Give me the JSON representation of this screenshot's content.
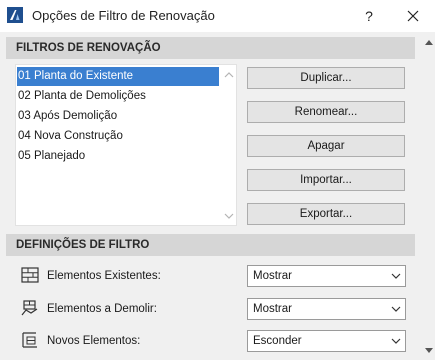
{
  "window": {
    "title": "Opções de Filtro de Renovação",
    "help_label": "?",
    "icon": "archicad-app-icon",
    "close_icon": "close-icon"
  },
  "filters_section": {
    "header": "FILTROS DE RENOVAÇÃO",
    "items": [
      {
        "label": "01 Planta do Existente",
        "selected": true
      },
      {
        "label": "02 Planta de Demolições",
        "selected": false
      },
      {
        "label": "03 Após Demolição",
        "selected": false
      },
      {
        "label": "04 Nova Construção",
        "selected": false
      },
      {
        "label": "05 Planejado",
        "selected": false
      }
    ],
    "buttons": {
      "duplicate": "Duplicar...",
      "rename": "Renomear...",
      "delete": "Apagar",
      "import": "Importar...",
      "export": "Exportar..."
    }
  },
  "settings_section": {
    "header": "DEFINIÇÕES DE FILTRO",
    "rows": [
      {
        "label": "Elementos Existentes:",
        "value": "Mostrar",
        "icon": "existing-elements-icon"
      },
      {
        "label": "Elementos a Demolir:",
        "value": "Mostrar",
        "icon": "demolish-elements-icon"
      },
      {
        "label": "Novos Elementos:",
        "value": "Esconder",
        "icon": "new-elements-icon"
      }
    ]
  },
  "colors": {
    "selection": "#3a7fd0",
    "section_header_bg": "#d6d6d6",
    "dialog_bg": "#f0f0f0"
  }
}
